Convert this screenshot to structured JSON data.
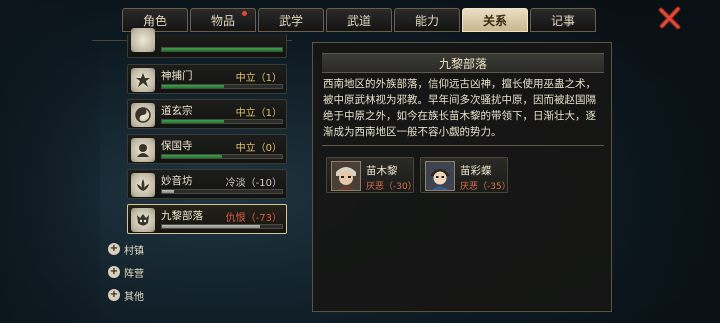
{
  "tabs": [
    {
      "label": "角色",
      "active": false,
      "badge": false
    },
    {
      "label": "物品",
      "active": false,
      "badge": true
    },
    {
      "label": "武学",
      "active": false,
      "badge": false
    },
    {
      "label": "武道",
      "active": false,
      "badge": false
    },
    {
      "label": "能力",
      "active": false,
      "badge": false
    },
    {
      "label": "关系",
      "active": true,
      "badge": false
    },
    {
      "label": "记事",
      "active": false,
      "badge": false
    }
  ],
  "factions": [
    {
      "name": "",
      "status": "",
      "level": 1.0,
      "bar": "green"
    },
    {
      "name": "神捕门",
      "status": "中立（1）",
      "level": 0.52,
      "bar": "green"
    },
    {
      "name": "道玄宗",
      "status": "中立（1）",
      "level": 0.52,
      "bar": "green"
    },
    {
      "name": "保国寺",
      "status": "中立（0）",
      "level": 0.5,
      "bar": "green"
    },
    {
      "name": "妙音坊",
      "status": "冷淡（-10）",
      "level": 0.1,
      "bar": "grey"
    },
    {
      "name": "九黎部落",
      "status": "仇恨（-73）",
      "level": 0.82,
      "bar": "grey"
    }
  ],
  "categories": [
    "村镇",
    "阵营",
    "其他"
  ],
  "detail": {
    "title": "九黎部落",
    "description": "西南地区的外族部落，信仰远古凶神，擅长使用巫蛊之术，被中原武林视为邪教。早年间多次骚扰中原，因而被赵国隔绝于中原之外，如今在族长苗木黎的带领下，日渐壮大，逐渐成为西南地区一般不容小觑的势力。",
    "members": [
      {
        "name": "苗木黎",
        "relation": "厌恶（-30）"
      },
      {
        "name": "苗彩蝶",
        "relation": "厌恶（-35）"
      }
    ]
  },
  "colors": {
    "accent_gold": "#d8c58f",
    "neutral": "#e0c170",
    "hate": "#e35a46",
    "dislike": "#d9704e",
    "bar_green": "#3aa24a",
    "close_red": "#e04a3a"
  }
}
